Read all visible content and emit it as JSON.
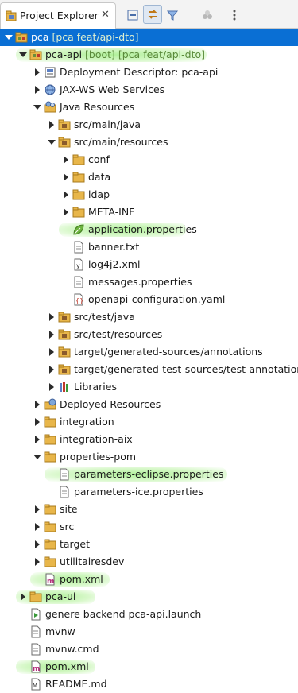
{
  "view": {
    "tab_title": "Project Explorer",
    "close_glyph": "✕",
    "toolbar": [
      {
        "name": "collapse-all-icon"
      },
      {
        "name": "link-with-editor-icon"
      },
      {
        "name": "filter-icon"
      },
      {
        "name": "cluster-icon"
      },
      {
        "name": "view-menu-icon"
      }
    ]
  },
  "tree": [
    {
      "label": "pca",
      "deco": " [pca feat/api-dto]",
      "level": 0,
      "expand": "down",
      "icon": "project",
      "selected": true
    },
    {
      "label": "pca-api",
      "deco": " [boot] [pca feat/api-dto]",
      "level": 1,
      "expand": "down",
      "icon": "project",
      "hl": 240
    },
    {
      "label": "Deployment Descriptor: pca-api",
      "level": 2,
      "expand": "right",
      "icon": "descriptor"
    },
    {
      "label": "JAX-WS Web Services",
      "level": 2,
      "expand": "right",
      "icon": "webservice"
    },
    {
      "label": "Java Resources",
      "level": 2,
      "expand": "down",
      "icon": "javares"
    },
    {
      "label": "src/main/java",
      "level": 3,
      "expand": "right",
      "icon": "package-folder"
    },
    {
      "label": "src/main/resources",
      "level": 3,
      "expand": "down",
      "icon": "package-folder"
    },
    {
      "label": "conf",
      "level": 4,
      "expand": "right",
      "icon": "folder"
    },
    {
      "label": "data",
      "level": 4,
      "expand": "right",
      "icon": "folder"
    },
    {
      "label": "ldap",
      "level": 4,
      "expand": "right",
      "icon": "folder"
    },
    {
      "label": "META-INF",
      "level": 4,
      "expand": "right",
      "icon": "folder"
    },
    {
      "label": "application.properties",
      "level": 4,
      "expand": "none",
      "icon": "spring-leaf",
      "hl": 160
    },
    {
      "label": "banner.txt",
      "level": 4,
      "expand": "none",
      "icon": "file"
    },
    {
      "label": "log4j2.xml",
      "level": 4,
      "expand": "none",
      "icon": "xml"
    },
    {
      "label": "messages.properties",
      "level": 4,
      "expand": "none",
      "icon": "file"
    },
    {
      "label": "openapi-configuration.yaml",
      "level": 4,
      "expand": "none",
      "icon": "yaml"
    },
    {
      "label": "src/test/java",
      "level": 3,
      "expand": "right",
      "icon": "package-folder"
    },
    {
      "label": "src/test/resources",
      "level": 3,
      "expand": "right",
      "icon": "package-folder"
    },
    {
      "label": "target/generated-sources/annotations",
      "level": 3,
      "expand": "right",
      "icon": "package-folder"
    },
    {
      "label": "target/generated-test-sources/test-annotations",
      "level": 3,
      "expand": "right",
      "icon": "package-folder"
    },
    {
      "label": "Libraries",
      "level": 3,
      "expand": "right",
      "icon": "library"
    },
    {
      "label": "Deployed Resources",
      "level": 2,
      "expand": "right",
      "icon": "deployed"
    },
    {
      "label": "integration",
      "level": 2,
      "expand": "right",
      "icon": "folder"
    },
    {
      "label": "integration-aix",
      "level": 2,
      "expand": "right",
      "icon": "folder"
    },
    {
      "label": "properties-pom",
      "level": 2,
      "expand": "down",
      "icon": "folder"
    },
    {
      "label": "parameters-eclipse.properties",
      "level": 3,
      "expand": "none",
      "icon": "file",
      "hl": 230
    },
    {
      "label": "parameters-ice.properties",
      "level": 3,
      "expand": "none",
      "icon": "file"
    },
    {
      "label": "site",
      "level": 2,
      "expand": "right",
      "icon": "folder"
    },
    {
      "label": "src",
      "level": 2,
      "expand": "right",
      "icon": "folder"
    },
    {
      "label": "target",
      "level": 2,
      "expand": "right",
      "icon": "folder"
    },
    {
      "label": "utilitairesdev",
      "level": 2,
      "expand": "right",
      "icon": "folder"
    },
    {
      "label": "pom.xml",
      "level": 2,
      "expand": "none",
      "icon": "maven",
      "hl": 100
    },
    {
      "label": "pca-ui",
      "level": 1,
      "expand": "right",
      "icon": "folder",
      "hl": 100
    },
    {
      "label": "genere backend pca-api.launch",
      "level": 1,
      "expand": "none",
      "icon": "launch"
    },
    {
      "label": "mvnw",
      "level": 1,
      "expand": "none",
      "icon": "file"
    },
    {
      "label": "mvnw.cmd",
      "level": 1,
      "expand": "none",
      "icon": "file"
    },
    {
      "label": "pom.xml",
      "level": 1,
      "expand": "none",
      "icon": "maven",
      "hl": 100
    },
    {
      "label": "README.md",
      "level": 1,
      "expand": "none",
      "icon": "md"
    }
  ],
  "colors": {
    "selection": "#0a6fd4",
    "folder": "#e8b64a",
    "highlight": "#a8f08c"
  }
}
